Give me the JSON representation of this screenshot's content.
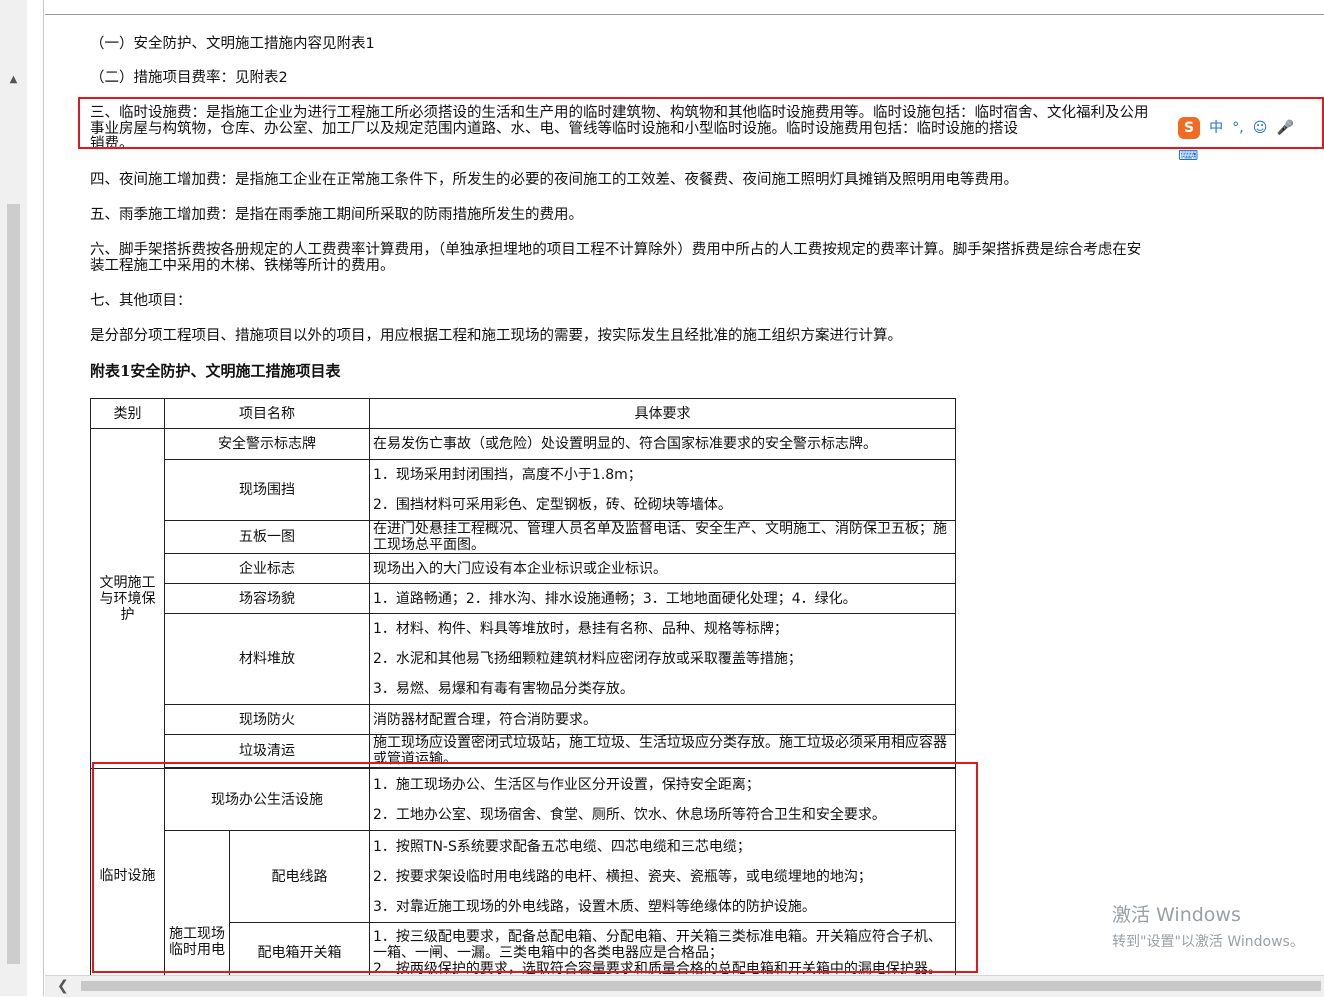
{
  "paragraphs": {
    "p1": "（一）安全防护、文明施工措施内容见附表1",
    "p2": "（二）措施项目费率：见附表2",
    "p3a": "三、临时设施费：是指施工企业为进行工程施工所必须搭设的生活和生产用的临时建筑物、构筑物和其他临时设施费用等。临时设施包括：临时宿舍、文化福利及公用",
    "p3b": "事业房屋与构筑物，仓库、办公室、加工厂以及规定范围内道路、水、电、管线等临时设施和小型临时设施。临时设施费用包括：临时设施的搭设",
    "p3c": "销费。",
    "p4": "四、夜间施工增加费：是指施工企业在正常施工条件下，所发生的必要的夜间施工的工效差、夜餐费、夜间施工照明灯具摊销及照明用电等费用。",
    "p5": "五、雨季施工增加费：是指在雨季施工期间所采取的防雨措施所发生的费用。",
    "p6a": "六、脚手架搭拆费按各册规定的人工费费率计算费用，（单独承担埋地的项目工程不计算除外）费用中所占的人工费按规定的费率计算。脚手架搭拆费是综合考虑在安",
    "p6b": "装工程施工中采用的木梯、铁梯等所计的费用。",
    "p7": "七、其他项目：",
    "p8": "是分部分项工程项目、措施项目以外的项目，用应根据工程和施工现场的需要，按实际发生且经批准的施工组织方案进行计算。",
    "heading": "附表1安全防护、文明施工措施项目表"
  },
  "table": {
    "headers": {
      "category": "类别",
      "item": "项目名称",
      "requirement": "具体要求"
    },
    "cat1": "文明施工与环境保护",
    "cat2": "临时设施",
    "r1": {
      "name": "安全警示标志牌",
      "req": "在易发伤亡事故（或危险）处设置明显的、符合国家标准要求的安全警示标志牌。"
    },
    "r2": {
      "name": "现场围挡",
      "req1": "1．现场采用封闭围挡，高度不小于1.8m；",
      "req2": "2．围挡材料可采用彩色、定型钢板，砖、砼砌块等墙体。"
    },
    "r3": {
      "name": "五板一图",
      "req": "在进门处悬挂工程概况、管理人员名单及监督电话、安全生产、文明施工、消防保卫五板；施工现场总平面图。"
    },
    "r4": {
      "name": "企业标志",
      "req": "现场出入的大门应设有本企业标识或企业标识。"
    },
    "r5": {
      "name": "场容场貌",
      "req": "1．道路畅通；2．排水沟、排水设施通畅；3．工地地面硬化处理；4．绿化。"
    },
    "r6": {
      "name": "材料堆放",
      "req1": "1．材料、构件、料具等堆放时，悬挂有名称、品种、规格等标牌；",
      "req2": "2．水泥和其他易飞扬细颗粒建筑材料应密闭存放或采取覆盖等措施；",
      "req3": "3．易燃、易爆和有毒有害物品分类存放。"
    },
    "r7": {
      "name": "现场防火",
      "req": "消防器材配置合理，符合消防要求。"
    },
    "r8": {
      "name": "垃圾清运",
      "req": "施工现场应设置密闭式垃圾站，施工垃圾、生活垃圾应分类存放。施工垃圾必须采用相应容器或管道运输。"
    },
    "r9": {
      "name": "现场办公生活设施",
      "req1": "1．施工现场办公、生活区与作业区分开设置，保持安全距离；",
      "req2": "2．工地办公室、现场宿舍、食堂、厕所、饮水、休息场所等符合卫生和安全要求。"
    },
    "sub": "施工现场临时用电",
    "r10": {
      "name": "配电线路",
      "req1": "1．按照TN-S系统要求配备五芯电缆、四芯电缆和三芯电缆；",
      "req2": "2．按要求架设临时用电线路的电杆、横担、瓷夹、瓷瓶等，或电缆埋地的地沟；",
      "req3": "3．对靠近施工现场的外电线路，设置木质、塑料等绝缘体的防护设施。"
    },
    "r11": {
      "name": "配电箱开关箱",
      "req1": "1．按三级配电要求，配备总配电箱、分配电箱、开关箱三类标准电箱。开关箱应符合子机、一箱、一闸、一漏。三类电箱中的各类电器应是合格品；",
      "req2": "2．按两级保护的要求，选取符合容量要求和质量合格的总配电箱和开关箱中的漏电保护器。"
    }
  },
  "ime": {
    "logo": "S",
    "mode": "中",
    "punct": "°,",
    "emoji": "☺",
    "mic": "🎤",
    "keyboard": "⌨"
  },
  "watermark": {
    "line1": "激活 Windows",
    "line2": "转到\"设置\"以激活 Windows。"
  },
  "colors": {
    "annotation": "#e0191e",
    "ime_blue": "#1d6fd8",
    "ime_logo": "#f26b22"
  }
}
